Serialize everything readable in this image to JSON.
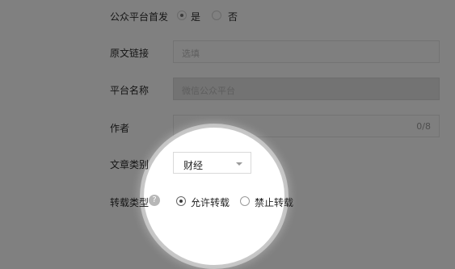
{
  "form": {
    "first_publish": {
      "label": "公众平台首发",
      "options": [
        {
          "label": "是",
          "checked": true
        },
        {
          "label": "否",
          "checked": false
        }
      ]
    },
    "source_link": {
      "label": "原文链接",
      "placeholder": "选填"
    },
    "platform_name": {
      "label": "平台名称",
      "value": "微信公众平台"
    },
    "author": {
      "label": "作者",
      "counter": "0/8"
    },
    "category": {
      "label": "文章类别",
      "selected": "财经"
    },
    "repost_type": {
      "label": "转载类型",
      "help_glyph": "?",
      "options": [
        {
          "label": "允许转载",
          "checked": true
        },
        {
          "label": "禁止转载",
          "checked": false
        }
      ]
    }
  },
  "icons": {
    "help": "question-circle-icon",
    "dropdown": "caret-down-icon"
  },
  "colors": {
    "dim_overlay": "#808080",
    "spotlight": "#ffffff"
  }
}
